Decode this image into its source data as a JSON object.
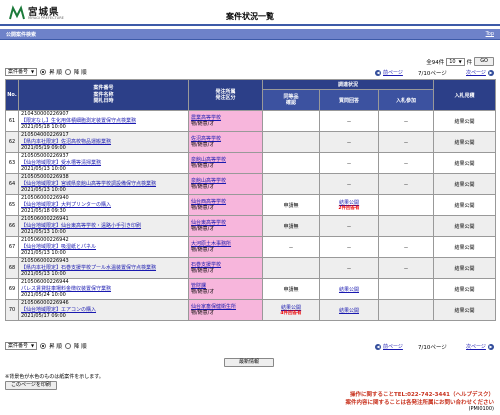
{
  "header": {
    "logo_text": "宮城県",
    "logo_subtext": "MIYAGI PREFECTURE",
    "title": "案件状況一覧"
  },
  "public_bar": {
    "title": "公開案件検索",
    "top_link": "Top"
  },
  "controls_top": {
    "total": "全94件",
    "per_page_value": "10",
    "per_page_unit": "件",
    "pages": "7/10ページ",
    "prev": "前ページ",
    "next": "次ページ",
    "sort_value": "案件番号",
    "radio_asc": "昇 順",
    "radio_desc": "降 順",
    "go": "GO"
  },
  "table": {
    "headers": {
      "no": "No.",
      "case": "案件番号\n案件名称\n開札日時",
      "org": "発注所属\n発注区分",
      "bidding_status": "調達状況",
      "equal_check": "同等品\n確認",
      "qa": "質問回答",
      "entry": "入札参加",
      "result": "入札見積"
    },
    "rows": [
      {
        "no": "61",
        "id": "210430000226907",
        "name": "【限定なし】生化用体積細胞測定装置保守点検業務",
        "date": "2021/05/18 10:00",
        "org": "農業高等学校",
        "type": "物/随意/オ",
        "equal": "",
        "qa": "－",
        "qa_note": "",
        "entry": "－",
        "result": "結果公開"
      },
      {
        "no": "62",
        "id": "210504000226917",
        "name": "【県内本社限定】佐沼高校物品運搬業務",
        "date": "2021/05/19 09:00",
        "org": "佐沼高等学校",
        "type": "物/随意/オ",
        "equal": "",
        "qa": "－",
        "qa_note": "",
        "entry": "－",
        "result": "結果公開"
      },
      {
        "no": "63",
        "id": "210505000226937",
        "name": "【仙台地域限定】受水槽等清掃業務",
        "date": "2021/05/13 10:00",
        "org": "泉館山高等学校",
        "type": "物/随意/オ",
        "equal": "",
        "qa": "－",
        "qa_note": "",
        "entry": "－",
        "result": "結果公開"
      },
      {
        "no": "64",
        "id": "210505000226938",
        "name": "【仙台地域限定】宮城県泉館山高等学校調設備保守点検業務",
        "date": "2021/05/13 10:00",
        "org": "泉館山高等学校",
        "type": "物/随意/オ",
        "equal": "",
        "qa": "－",
        "qa_note": "",
        "entry": "－",
        "result": "結果公開"
      },
      {
        "no": "65",
        "id": "210506000226940",
        "name": "【仙台地域限定】大判プリンターの購入",
        "date": "2021/05/18 09:30",
        "org": "仙台西高等学校",
        "type": "物/随意/オ",
        "equal": "申請無",
        "qa": "結果公開",
        "qa_note": "2件回答有",
        "entry": "",
        "result": "結果公開"
      },
      {
        "no": "66",
        "id": "210506000226941",
        "name": "【仙台地域限定】仙台東高等学校・遠路小手引き印刷",
        "date": "2021/05/13 10:00",
        "org": "仙台東高等学校",
        "type": "物/随意/オ",
        "equal": "申請無",
        "qa": "－",
        "qa_note": "",
        "entry": "",
        "result": "結果公開"
      },
      {
        "no": "67",
        "id": "210506000226942",
        "name": "【仙台地域限定】吸湿紙とパネル",
        "date": "2021/05/13 10:00",
        "org": "大河原土木事務所",
        "type": "物/随意/オ",
        "equal": "－",
        "qa": "－",
        "qa_note": "",
        "entry": "－",
        "result": "結果公開"
      },
      {
        "no": "68",
        "id": "210506000226943",
        "name": "【県内本社限定】石巻支援学校プール水温装置保守点検業務",
        "date": "2021/05/13 10:00",
        "org": "石巻支援学校",
        "type": "物/随意/オ",
        "equal": "",
        "qa": "－",
        "qa_note": "",
        "entry": "－",
        "result": "結果公開"
      },
      {
        "no": "69",
        "id": "210506000226944",
        "name": "パレス賃貸駐車場料金徴収装置保守業務",
        "date": "2021/05/24 10:00",
        "org": "管財課",
        "type": "物/随意/オ",
        "equal": "申請無",
        "qa": "結果公開",
        "qa_note": "",
        "entry": "",
        "result": "結果公開"
      },
      {
        "no": "70",
        "id": "210506000226946",
        "name": "【仙台地域限定】エアコンの購入",
        "date": "2021/05/17 09:00",
        "org": "仙台家畜保健衛生所",
        "type": "物/随意/オ",
        "equal": "結果公開",
        "qa": "結果公開",
        "qa_note": "",
        "entry": "",
        "result": "結果公開",
        "equal_note": "4件回答有"
      }
    ]
  },
  "controls_bottom": {
    "sort_value": "案件番号",
    "radio_asc": "昇 順",
    "radio_desc": "降 順",
    "go": "GO",
    "prev": "前ページ",
    "pages": "7/10ページ",
    "next": "次ページ",
    "latest_button": "最新情報"
  },
  "footer": {
    "note": "※背景色が水色のものは紙案件を示します。",
    "print_button": "このページを印刷",
    "contact_operation": "操作に関することTEL:022-742-3441（ヘルプデスク）",
    "contact_content": "案件内容に関することは各発注所属にお問い合わせください",
    "page_id": "(PMI0100)"
  },
  "colors": {
    "header_blue": "#2c3f88",
    "bar_blue": "#6e82c9",
    "org_pink": "#f7b6dc",
    "note_red": "#c8321e"
  }
}
